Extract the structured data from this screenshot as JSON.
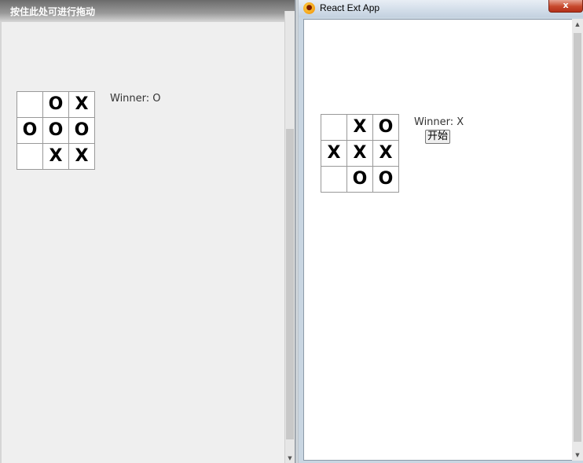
{
  "left_window": {
    "drag_hint": "按住此处可进行拖动",
    "board": [
      "",
      "O",
      "X",
      "O",
      "O",
      "O",
      "",
      "X",
      "X"
    ],
    "status": "Winner: O"
  },
  "right_window": {
    "title": "React Ext App",
    "app_icon": "react-ext-icon",
    "close_label": "x",
    "board": [
      "",
      "X",
      "O",
      "X",
      "X",
      "X",
      "",
      "O",
      "O"
    ],
    "status": "Winner: X",
    "start_label": "开始"
  },
  "colors": {
    "panel_bg": "#efefef",
    "cell_border": "#999999",
    "close_red": "#c7482d"
  }
}
